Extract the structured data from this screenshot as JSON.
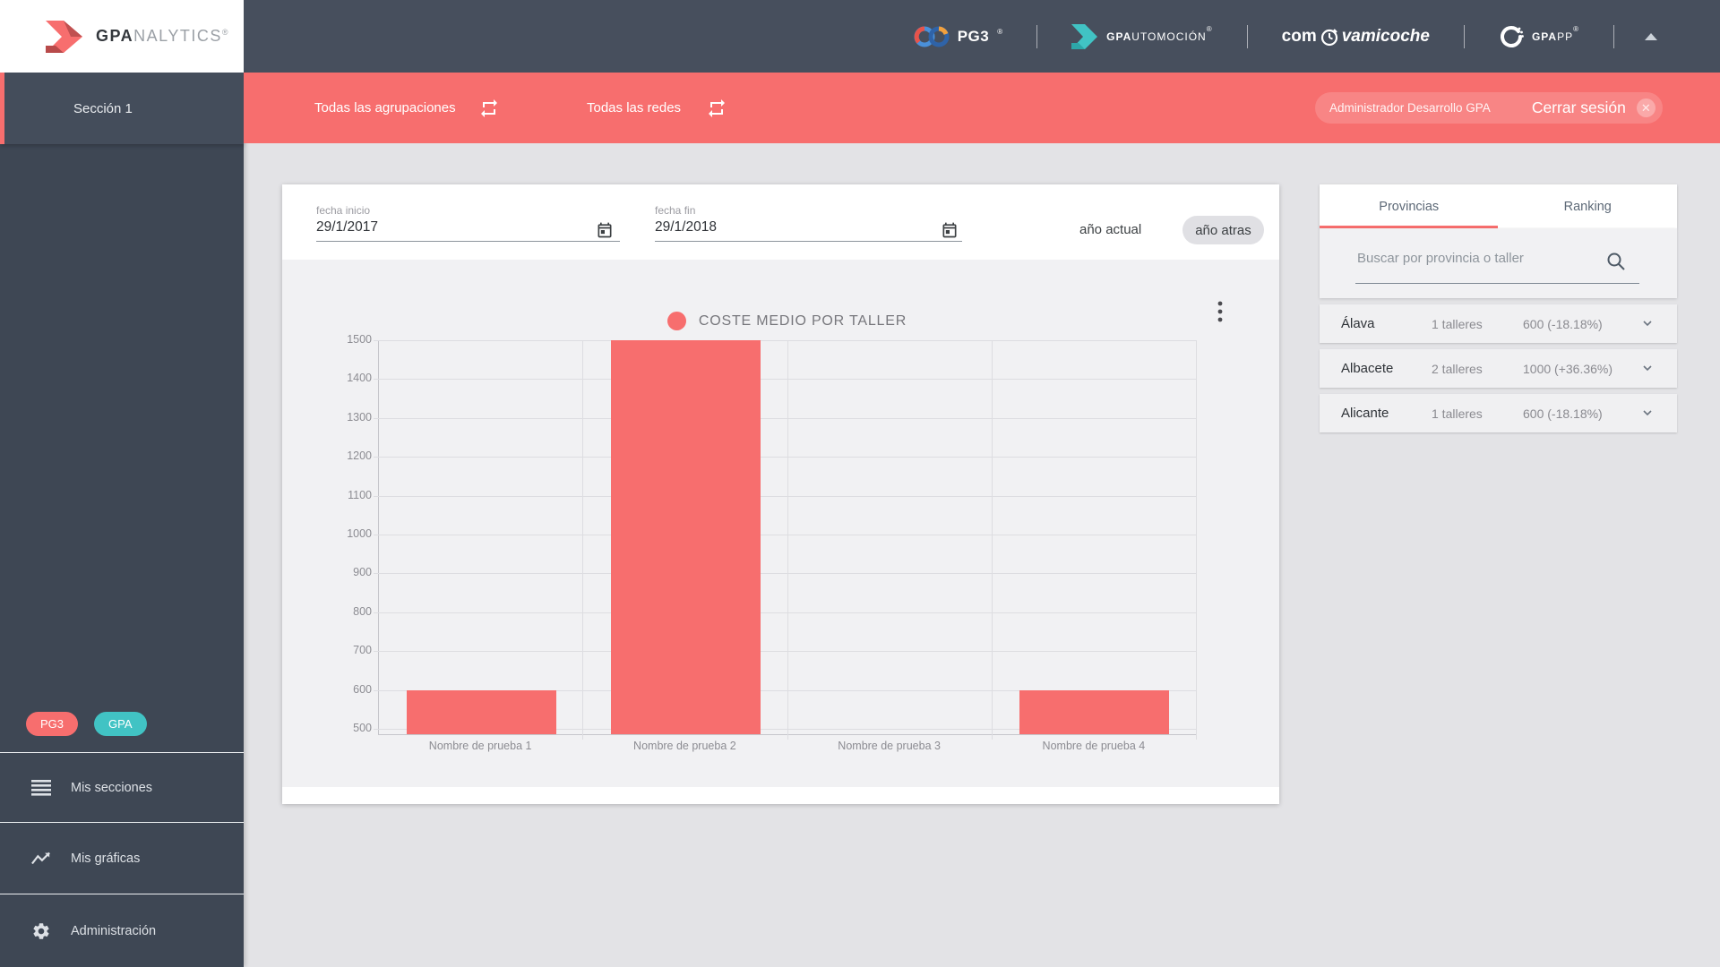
{
  "app": {
    "brand_bold": "GPA",
    "brand_light": "NALYTICS",
    "reg": "®"
  },
  "topbar": {
    "pg3": {
      "label": "PG3",
      "reg": "®"
    },
    "gpautomocion": {
      "bold": "GPA",
      "light": "UTOMOCIÓN",
      "reg": "®"
    },
    "comprovamicoche": {
      "pre": "com",
      "post": "vamicoche"
    },
    "gpapp": {
      "bold": "GPA",
      "light": "PP",
      "reg": "®"
    }
  },
  "sidebar": {
    "section_label": "Sección 1",
    "badges": [
      {
        "label": "PG3",
        "color": "#f76e6e"
      },
      {
        "label": "GPA",
        "color": "#41c3c4"
      }
    ],
    "menu": [
      {
        "label": "Mis secciones",
        "icon": "list-icon"
      },
      {
        "label": "Mis gráficas",
        "icon": "trending-icon"
      },
      {
        "label": "Administración",
        "icon": "gear-icon"
      }
    ]
  },
  "filterbar": {
    "groupings_label": "Todas las agrupaciones",
    "networks_label": "Todas las redes",
    "user_label": "Administrador Desarrollo GPA",
    "logout_label": "Cerrar sesión"
  },
  "controls": {
    "date_start": {
      "label": "fecha inicio",
      "value": "29/1/2017"
    },
    "date_end": {
      "label": "fecha fin",
      "value": "29/1/2018"
    },
    "current_year_label": "año actual",
    "previous_year_label": "año atras"
  },
  "chart_data": {
    "type": "bar",
    "title": "COSTE MEDIO POR TALLER",
    "categories": [
      "Nombre de prueba 1",
      "Nombre de prueba 2",
      "Nombre de prueba 3",
      "Nombre de prueba 4"
    ],
    "values": [
      600,
      1500,
      500,
      600
    ],
    "ylim": [
      500,
      1500
    ],
    "ytick_step": 100,
    "bar_color": "#f76e6e",
    "grid": true,
    "legend_position": "top-center"
  },
  "right_panel": {
    "tabs": [
      {
        "label": "Provincias",
        "active": true
      },
      {
        "label": "Ranking",
        "active": false
      }
    ],
    "search_placeholder": "Buscar por provincia o taller",
    "rows": [
      {
        "province": "Álava",
        "talleres": "1 talleres",
        "value": "600 (-18.18%)"
      },
      {
        "province": "Albacete",
        "talleres": "2 talleres",
        "value": "1000 (+36.36%)"
      },
      {
        "province": "Alicante",
        "talleres": "1 talleres",
        "value": "600 (-18.18%)"
      }
    ]
  },
  "icons": {
    "swap": "repeat-arrows",
    "calendar": "calendar",
    "search": "magnifier",
    "close": "x-circle",
    "menu_more": "kebab-vertical",
    "collapse": "caret-up"
  },
  "colors": {
    "accent": "#f76e6e",
    "teal": "#41c3c4",
    "topbar": "#474f5d",
    "sidebar": "#3e4754",
    "page_bg": "#e3e3e6",
    "panel_gray": "#f1f1f3"
  }
}
